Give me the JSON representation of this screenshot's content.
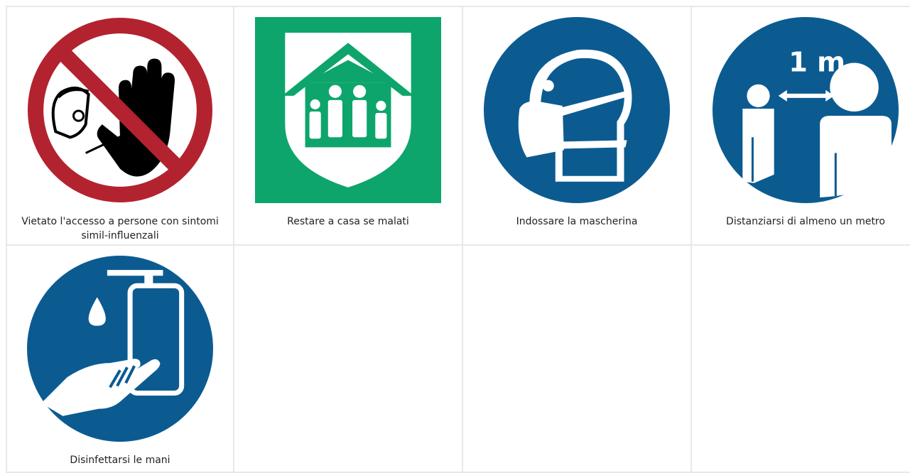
{
  "signs": [
    {
      "caption": "Vietato l'accesso a persone con sintomi simil-influenzali",
      "icon": "no-entry-hand-icon",
      "color": "#b3232f"
    },
    {
      "caption": "Restare a casa se malati",
      "icon": "stay-home-shelter-icon",
      "color": "#0da56b"
    },
    {
      "caption": "Indossare la mascherina",
      "icon": "face-mask-icon",
      "color": "#0b5b91"
    },
    {
      "caption": "Distanziarsi di almeno un metro",
      "icon": "social-distance-icon",
      "color": "#0b5b91",
      "distance_label": "1 m"
    },
    {
      "caption": "Disinfettarsi le mani",
      "icon": "hand-sanitizer-icon",
      "color": "#0b5b91"
    }
  ]
}
